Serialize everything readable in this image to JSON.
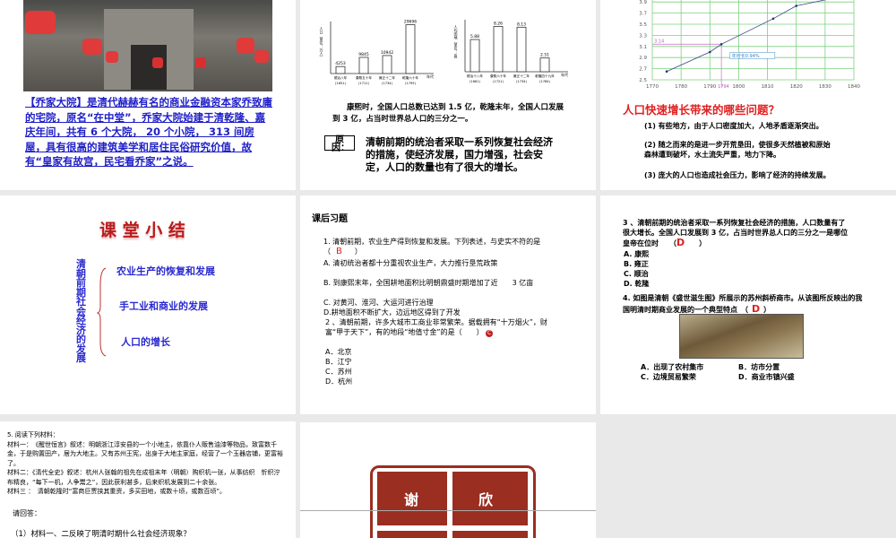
{
  "slides": [
    {
      "photo_alt": "乔家大院",
      "text": "【乔家大院】是清代赫赫有名的商业金融资本家乔致庸的宅院，原名“在中堂”，乔家大院始建于清乾隆、嘉庆年间，共有 6 个大院， 20 个小院， 313 间房屋，具有很高的建筑美学和居住民俗研究价值，故有“皇家有故宫，民宅看乔家”之说。"
    },
    {
      "caption": "康熙时，全国人口总数已达到 1.5 亿，乾隆末年，全国人口发展到 3 亿，占当时世界总人口的三分之一。",
      "reason_label": "原因：",
      "reason_text": "清朝前期的统治者采取一系列恢复社会经济的措施，使经济发展，国力增强，社会安定，人口的数量也有了很大的增长。"
    },
    {
      "question": "人口快速增长带来的哪些问题？",
      "points": [
        "(1) 有些地方，由于人口密度加大，人地矛盾逐渐突出。",
        "(2) 随之而来的是进一步开荒垦田，使很多天然植被和原始森林遭到破坏，水土流失严重，地力下降。",
        "(3) 庞大的人口也造成社会压力，影响了经济的持续发展。"
      ]
    },
    {
      "title": "课 堂 小 结",
      "vertical": "清朝前期社会经济的发展",
      "items": [
        "农业生产的恢复和发展",
        "手工业和商业的发展",
        "人口的增长"
      ]
    },
    {
      "title": "课后习题",
      "q1": "1. 清朝前期，农业生产得到恢复和发展。下列表述，与史实不符的是（",
      "q1_answer": "B",
      "q1_close": "）",
      "q1_options": [
        "A. 清初统治者都十分重视农业生产，大力推行垦荒政策",
        "B. 到康熙末年，全国耕地面积比明朝鼎盛时期增加了近　　3 亿亩",
        "C. 对黄河、淮河、大运河进行治理",
        "D.耕地面积不断扩大，边远地区得到了开发"
      ],
      "q2": "2 、清朝前期，许多大城市工商业非常繁荣。据载拥有“十万烟火”，财富“甲于天下”，有的地段“地值寸金”的是（　　）",
      "q2_answer": "C",
      "q2_options": [
        "A．北京",
        "B．江宁",
        "C．苏州",
        "D．杭州"
      ]
    },
    {
      "q3": "3 、清朝前期的统治者采取一系列恢复社会经济的措施，人口数量有了很大增长。全国人口发展到 3 亿，占当时世界总人口的三分之一是哪位皇帝在位时　　（",
      "q3_answer": "D",
      "q3_close": "　　）",
      "q3_options": [
        "A. 康熙",
        "B. 雍正",
        "C. 顺治",
        "D. 乾隆"
      ],
      "q4": "4. 如图是清朝《盛世滋生图》所展示的苏州斜桥商市。从该图所反映出的我国明清时期商业发展的一个典型特点　（",
      "q4_answer": "D",
      "q4_close": "）",
      "q4_options": [
        "A．出现了农村集市",
        "B．坊市分置",
        "C．边境贸易繁荣",
        "D．商业市镇兴盛"
      ]
    },
    {
      "lines": [
        "5. 阅读下列材料：",
        "材料一：　《醒世恒言》叙述：明朝浙江淳安县的一个小地主，依靠仆人贩售油漆等物品，致富数千金，于是购置田产，居为大地主。又有苏州王宪，出身于大地主家庭，经营了一个玉器店铺，更富裕了。",
        "材料二：《清代全史》叙述：杭州人张翰的祖先在成祖末年（明朝）购织机一张，从事纺织　忻织泞布精良，“每下一机，人争鬻之”，因此获利甚多，后来织机发展到二十余张。",
        "材料三 ：　清朝乾隆时“富商巨贾挟其重资，多买田地，或数十顷，或数百顷”。"
      ],
      "ask": "请回答：",
      "sub1": "（1）材料一、二反映了明清时期什么社会经济现象？"
    },
    {
      "seal": [
        "谢",
        "欣"
      ]
    }
  ],
  "chart_data": [
    {
      "type": "bar",
      "title": "",
      "ylabel": "人口（单位：万人）",
      "xlabel": "年代",
      "categories": [
        "顺治八年(1651)",
        "康熙五十年(1711)",
        "雍正十二年(1734)",
        "乾隆六十年(1795)"
      ],
      "values": [
        4253,
        9845,
        10942,
        29696
      ],
      "ylim": [
        0,
        30000
      ]
    },
    {
      "type": "bar",
      "title": "",
      "ylabel": "人均田地（单位：亩）",
      "xlabel": "年代",
      "categories": [
        "顺治十八年(1661)",
        "康熙六十年(1721)",
        "雍正十二年(1734)",
        "乾隆四十九年(1784)"
      ],
      "values": [
        5.88,
        8.26,
        8.13,
        2.51
      ],
      "ylim": [
        0,
        9
      ]
    },
    {
      "type": "line",
      "title": "",
      "x": [
        1775,
        1790,
        1794,
        1812,
        1820,
        1833
      ],
      "y": [
        2.65,
        3.0,
        3.14,
        3.6,
        3.83,
        3.97
      ],
      "xticks": [
        1770,
        1780,
        1790,
        1800,
        1810,
        1820,
        1830,
        1840
      ],
      "yticks": [
        2.5,
        2.7,
        2.9,
        3.1,
        3.3,
        3.5,
        3.7,
        3.9
      ],
      "xlim": [
        1770,
        1840
      ],
      "ylim": [
        2.5,
        4.0
      ],
      "annotations": [
        "3.14",
        "1794",
        "年增长0.94%"
      ],
      "grid": true
    }
  ]
}
